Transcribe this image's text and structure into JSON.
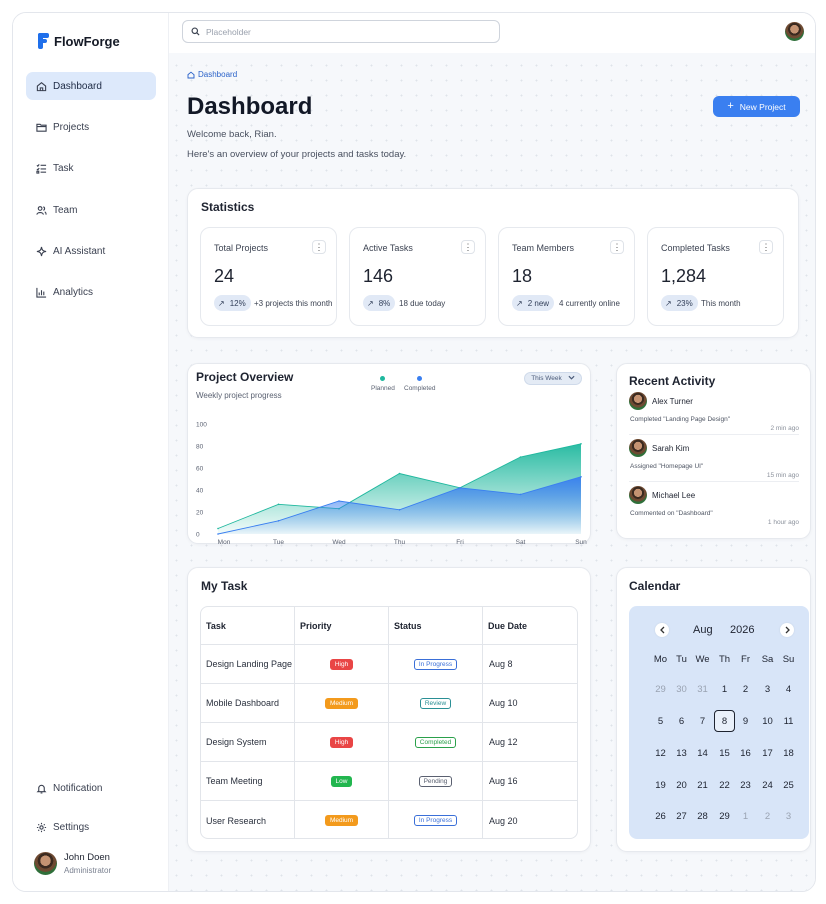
{
  "app": {
    "name": "FlowForge"
  },
  "sidebar": {
    "items": [
      {
        "label": "Dashboard",
        "icon": "home-icon",
        "active": true
      },
      {
        "label": "Projects",
        "icon": "folder-icon"
      },
      {
        "label": "Task",
        "icon": "checklist-icon"
      },
      {
        "label": "Team",
        "icon": "users-icon"
      },
      {
        "label": "AI Assistant",
        "icon": "sparkle-icon"
      },
      {
        "label": "Analytics",
        "icon": "bar-chart-icon"
      }
    ],
    "bottom": [
      {
        "label": "Notification",
        "icon": "bell-icon"
      },
      {
        "label": "Settings",
        "icon": "gear-icon"
      }
    ],
    "user": {
      "name": "John Doen",
      "role": "Administrator"
    }
  },
  "search": {
    "placeholder": "Placeholder"
  },
  "breadcrumb": {
    "label": "Dashboard"
  },
  "header": {
    "title": "Dashboard",
    "welcome": "Welcome back, Rian.",
    "subtitle": "Here's an overview of your projects and tasks today.",
    "new_button": "New Project"
  },
  "statistics": {
    "title": "Statistics",
    "cards": [
      {
        "label": "Total Projects",
        "value": "24",
        "change": "12%",
        "note": "+3 projects this month"
      },
      {
        "label": "Active Tasks",
        "value": "146",
        "change": "8%",
        "note": "18 due today"
      },
      {
        "label": "Team Members",
        "value": "18",
        "change": "2 new",
        "note": "4 currently online"
      },
      {
        "label": "Completed Tasks",
        "value": "1,284",
        "change": "23%",
        "note": "This month"
      }
    ]
  },
  "project_overview": {
    "title": "Project Overview",
    "subtitle": "Weekly project progress",
    "period": "This Week"
  },
  "chart_data": {
    "type": "area",
    "categories": [
      "Mon",
      "Tue",
      "Wed",
      "Thu",
      "Fri",
      "Sat",
      "Sun"
    ],
    "series": [
      {
        "name": "Planned",
        "color": "#1fb89e",
        "values": [
          5,
          27,
          23,
          55,
          42,
          70,
          82
        ]
      },
      {
        "name": "Completed",
        "color": "#3a7ff0",
        "values": [
          0,
          12,
          30,
          22,
          42,
          36,
          52
        ]
      }
    ],
    "yticks": [
      0,
      20,
      40,
      60,
      80,
      100
    ],
    "ylim": [
      0,
      100
    ],
    "grid": false,
    "legend": "top"
  },
  "recent_activity": {
    "title": "Recent Activity",
    "items": [
      {
        "name": "Alex Turner",
        "action": "Completed \"Landing Page Design\"",
        "time": "2 min ago"
      },
      {
        "name": "Sarah Kim",
        "action": "Assigned \"Homepage UI\"",
        "time": "15 min ago"
      },
      {
        "name": "Michael Lee",
        "action": "Commented on \"Dashboard\"",
        "time": "1 hour ago"
      }
    ]
  },
  "my_task": {
    "title": "My Task",
    "columns": [
      "Task",
      "Priority",
      "Status",
      "Due Date"
    ],
    "rows": [
      {
        "task": "Design Landing Page",
        "priority": "High",
        "status": "In Progress",
        "due": "Aug 8"
      },
      {
        "task": "Mobile Dashboard",
        "priority": "Medium",
        "status": "Review",
        "due": "Aug 10"
      },
      {
        "task": "Design System",
        "priority": "High",
        "status": "Completed",
        "due": "Aug 12"
      },
      {
        "task": "Team Meeting",
        "priority": "Low",
        "status": "Pending",
        "due": "Aug 16"
      },
      {
        "task": "User Research",
        "priority": "Medium",
        "status": "In Progress",
        "due": "Aug 20"
      }
    ],
    "priority_colors": {
      "High": "#e94545",
      "Medium": "#f39a1c",
      "Low": "#22b64f"
    },
    "status_colors": {
      "In Progress": "#3a6fd8",
      "Review": "#2a8f95",
      "Completed": "#2aa04a",
      "Pending": "#5a6070"
    }
  },
  "calendar": {
    "title": "Calendar",
    "month": "Aug",
    "year": "2026",
    "weekdays": [
      "Mo",
      "Tu",
      "We",
      "Th",
      "Fr",
      "Sa",
      "Su"
    ],
    "weeks": [
      [
        "29",
        "30",
        "31",
        "1",
        "2",
        "3",
        "4"
      ],
      [
        "5",
        "6",
        "7",
        "8",
        "9",
        "10",
        "11"
      ],
      [
        "12",
        "13",
        "14",
        "15",
        "16",
        "17",
        "18"
      ],
      [
        "19",
        "20",
        "21",
        "22",
        "23",
        "24",
        "25"
      ],
      [
        "26",
        "27",
        "28",
        "29",
        "1",
        "2",
        "3"
      ]
    ],
    "muted": [
      [
        0,
        0
      ],
      [
        0,
        1
      ],
      [
        0,
        2
      ],
      [
        4,
        4
      ],
      [
        4,
        5
      ],
      [
        4,
        6
      ]
    ],
    "selected": [
      1,
      3
    ]
  }
}
